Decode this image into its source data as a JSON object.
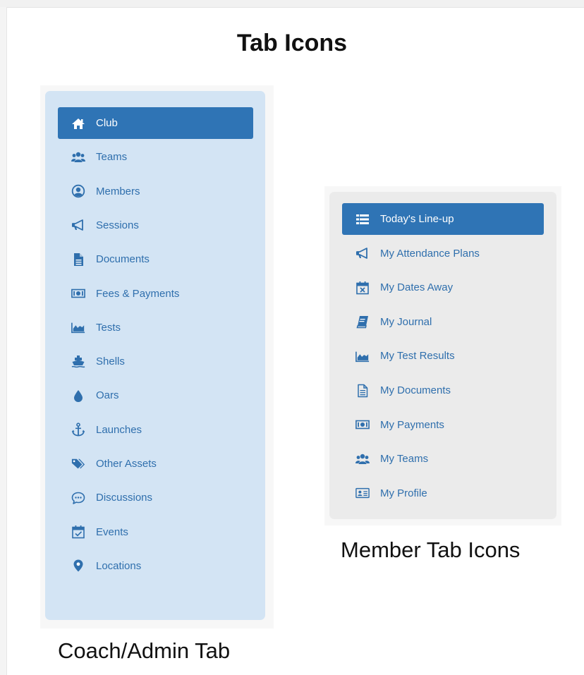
{
  "page": {
    "title": "Tab Icons"
  },
  "coach_panel": {
    "caption": "Coach/Admin Tab",
    "items": [
      {
        "label": "Club",
        "icon": "home-icon",
        "active": true
      },
      {
        "label": "Teams",
        "icon": "users-icon"
      },
      {
        "label": "Members",
        "icon": "user-circle-icon"
      },
      {
        "label": "Sessions",
        "icon": "megaphone-icon"
      },
      {
        "label": "Documents",
        "icon": "file-icon"
      },
      {
        "label": "Fees & Payments",
        "icon": "money-icon"
      },
      {
        "label": "Tests",
        "icon": "area-chart-icon"
      },
      {
        "label": "Shells",
        "icon": "ship-icon"
      },
      {
        "label": "Oars",
        "icon": "drop-icon"
      },
      {
        "label": "Launches",
        "icon": "anchor-icon"
      },
      {
        "label": "Other Assets",
        "icon": "tags-icon"
      },
      {
        "label": "Discussions",
        "icon": "comment-icon"
      },
      {
        "label": "Events",
        "icon": "calendar-check-icon"
      },
      {
        "label": "Locations",
        "icon": "map-marker-icon"
      }
    ]
  },
  "member_panel": {
    "caption": "Member Tab Icons",
    "items": [
      {
        "label": "Today's Line-up",
        "icon": "list-icon",
        "active": true
      },
      {
        "label": "My Attendance Plans",
        "icon": "megaphone-icon"
      },
      {
        "label": "My Dates Away",
        "icon": "calendar-times-icon"
      },
      {
        "label": "My Journal",
        "icon": "book-icon"
      },
      {
        "label": "My Test Results",
        "icon": "area-chart-icon"
      },
      {
        "label": "My Documents",
        "icon": "file-text-icon"
      },
      {
        "label": "My Payments",
        "icon": "money-icon"
      },
      {
        "label": "My Teams",
        "icon": "users-icon"
      },
      {
        "label": "My Profile",
        "icon": "id-card-icon"
      }
    ]
  },
  "colors": {
    "accent": "#2f74b5",
    "link": "#2f6fad",
    "coach_panel_bg": "#d3e4f4",
    "member_panel_bg": "#ebebeb"
  }
}
